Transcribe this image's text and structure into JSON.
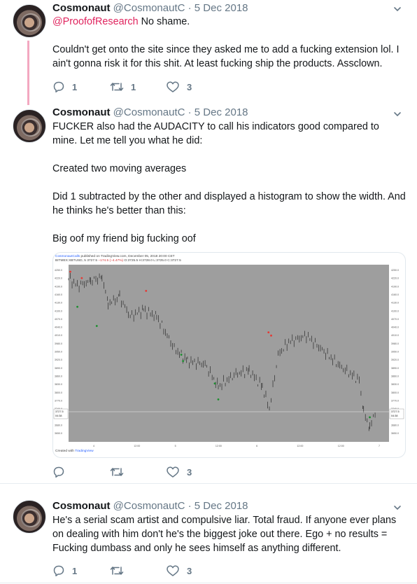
{
  "tweets": [
    {
      "name": "Cosmonaut",
      "handle": "@CosmonautC",
      "dot": "·",
      "date": "5 Dec 2018",
      "mention": "@ProofofResearch",
      "first_line_rest": " No shame.",
      "paragraphs": [
        "Couldn't get onto the site since they asked me to add a fucking extension lol. I ain't gonna risk it for this shit. At least fucking ship the products. Assclown."
      ],
      "replies": "1",
      "retweets": "1",
      "likes": "3"
    },
    {
      "name": "Cosmonaut",
      "handle": "@CosmonautC",
      "dot": "·",
      "date": "5 Dec 2018",
      "paragraphs": [
        "FUCKER also had the AUDACITY to call his indicators good compared to mine. Let me tell you what he did:",
        "Created two moving averages",
        "Did 1 subtracted by the other and displayed a histogram to show the width. And he thinks he's better than this:",
        "Big oof my friend big fucking oof"
      ],
      "replies": "",
      "retweets": "",
      "likes": "3"
    },
    {
      "name": "Cosmonaut",
      "handle": "@CosmonautC",
      "dot": "·",
      "date": "5 Dec 2018",
      "paragraphs": [
        "He's a serial scam artist and compulsive liar. Total fraud. If anyone ever plans on dealing with him don't he's the biggest joke out there. Ego + no results = Fucking dumbass and only he sees himself as anything different."
      ],
      "replies": "1",
      "retweets": "",
      "likes": "3"
    }
  ],
  "chart_image": {
    "header_author": "CosmonautCalls",
    "header_rest": " published on TradingView.com, December 05, 2018 20:00 CET",
    "symbol_line": "BITMEX:XBTUSD, 5 3727.5",
    "symbol_change": "−174.5 (−4.47%)",
    "symbol_ohlc": " O:3725.5 H:3728.0 L:3725.0 C:3727.5",
    "price_labels": [
      "4250.0",
      "4220.0",
      "4190.0",
      "4160.0",
      "4130.0",
      "4100.0",
      "4070.0",
      "4040.0",
      "4010.0",
      "3980.0",
      "3950.0",
      "3920.0",
      "3890.0",
      "3860.0",
      "3830.0",
      "3800.0",
      "3770.0",
      "3740.0",
      "3710.0",
      "3680.0",
      "3650.0"
    ],
    "current_price": "3727.5",
    "countdown": "04:38",
    "time_labels": [
      "4",
      "12:00",
      "5",
      "12:00",
      "6",
      "12:00",
      "12:00",
      "7"
    ],
    "created_with": "Created with ",
    "tv_brand": "TradingView",
    "colors": {
      "plot_bg": "#9e9e9e",
      "buy": "#1b8f2e",
      "sell": "#e53935",
      "candle": "#2b2b2b"
    }
  },
  "icons": {
    "reply": "reply-icon",
    "retweet": "retweet-icon",
    "like": "heart-icon",
    "more": "chevron-down-icon"
  }
}
